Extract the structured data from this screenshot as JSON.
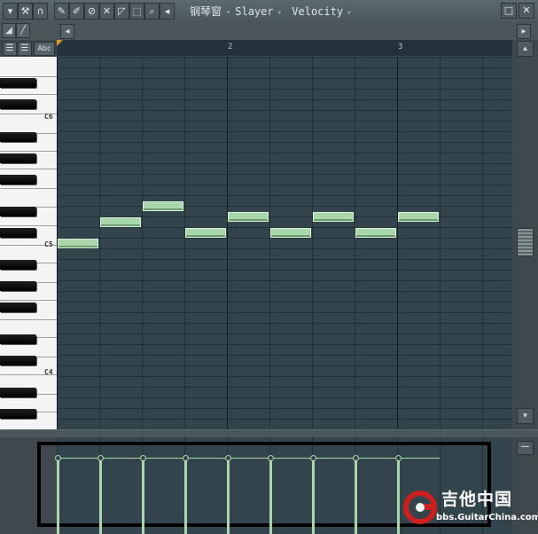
{
  "window": {
    "title_main": "钢琴窗",
    "title_sep": "-",
    "channel": "Slayer",
    "target": "Velocity",
    "dropdown_glyph": "▾"
  },
  "toolbar": {
    "menu_arrow": "▾",
    "tools": [
      "wrench-icon",
      "magnet-icon",
      "pencil-icon",
      "brush-icon",
      "delete-icon",
      "mute-icon",
      "slice-icon",
      "select-icon",
      "zoom-icon",
      "playback-icon"
    ],
    "left_button": "◂",
    "right_button": "▸",
    "close_label": "✕",
    "max_label": "□"
  },
  "keyboard": {
    "labels": [
      "C6",
      "C5",
      "C4"
    ],
    "view_buttons": [
      "☰",
      "☰",
      "Abc"
    ]
  },
  "timeline": {
    "bars": [
      "2",
      "3"
    ]
  },
  "notes": [
    {
      "step": 0,
      "pitch": "C5"
    },
    {
      "step": 1,
      "pitch": "E5"
    },
    {
      "step": 2,
      "pitch": "G5"
    },
    {
      "step": 3,
      "pitch": "D5"
    },
    {
      "step": 4,
      "pitch": "F5"
    },
    {
      "step": 5,
      "pitch": "D5"
    },
    {
      "step": 6,
      "pitch": "F5"
    },
    {
      "step": 7,
      "pitch": "D5"
    },
    {
      "step": 8,
      "pitch": "F5"
    }
  ],
  "velocity": {
    "values": [
      1,
      1,
      1,
      1,
      1,
      1,
      1,
      1,
      1
    ]
  },
  "scroll": {
    "up": "▴",
    "down": "▾",
    "minus": "—"
  },
  "watermark": {
    "title": "吉他中国",
    "url": "bbs.GuitarChina.com"
  },
  "colors": {
    "note": "#a9d6ab",
    "grid_bg": "#34444c",
    "accent": "#e0962f"
  }
}
